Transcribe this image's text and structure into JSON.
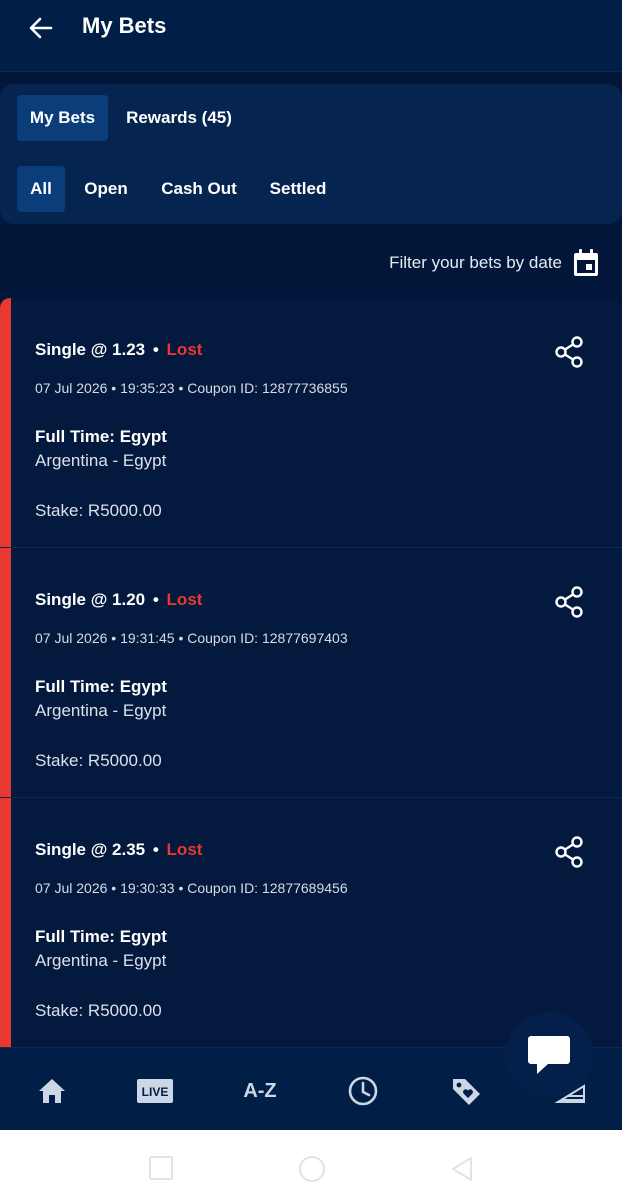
{
  "header": {
    "title": "My Bets"
  },
  "tabs": [
    {
      "label": "My Bets",
      "active": true
    },
    {
      "label": "Rewards (45)",
      "active": false
    }
  ],
  "filters": [
    {
      "label": "All",
      "active": true
    },
    {
      "label": "Open",
      "active": false
    },
    {
      "label": "Cash Out",
      "active": false
    },
    {
      "label": "Settled",
      "active": false
    }
  ],
  "date_filter": {
    "label": "Filter your bets by date",
    "icon": "calendar-icon"
  },
  "bets": [
    {
      "type": "Single @ 1.23",
      "separator": "•",
      "status": "Lost",
      "meta": "07 Jul 2026 • 19:35:23 • Coupon ID: 12877736855",
      "market": "Full Time: Egypt",
      "event": "Argentina - Egypt",
      "stake": "Stake: R5000.00"
    },
    {
      "type": "Single @ 1.20",
      "separator": "•",
      "status": "Lost",
      "meta": "07 Jul 2026 • 19:31:45 • Coupon ID: 12877697403",
      "market": "Full Time: Egypt",
      "event": "Argentina - Egypt",
      "stake": "Stake: R5000.00"
    },
    {
      "type": "Single @ 2.35",
      "separator": "•",
      "status": "Lost",
      "meta": "07 Jul 2026 • 19:30:33 • Coupon ID: 12877689456",
      "market": "Full Time: Egypt",
      "event": "Argentina - Egypt",
      "stake": "Stake: R5000.00"
    }
  ],
  "bottom_nav": {
    "live_label": "LIVE",
    "az_label": "A-Z",
    "icons": [
      "home-icon",
      "live-icon",
      "az-icon",
      "clock-icon",
      "tag-heart-icon",
      "stadium-icon"
    ]
  },
  "colors": {
    "background": "#02163a",
    "header": "#011e46",
    "accent_active": "#0b3d7a",
    "lost": "#e8382f"
  }
}
